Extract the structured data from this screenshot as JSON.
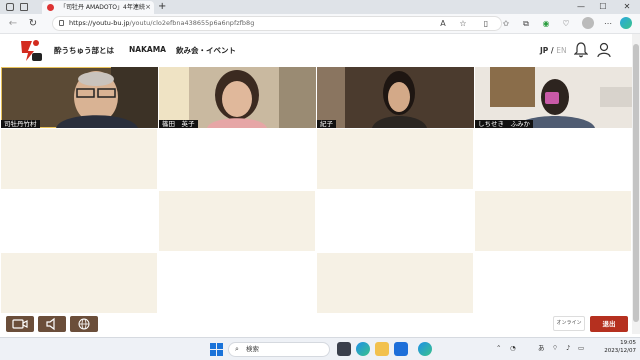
{
  "browser": {
    "tab_title": "「司牡丹 AMADOTO」4年連続",
    "tab_close": "×",
    "new_tab": "+",
    "url_domain": "https://youtu-bu.jp",
    "url_path": "/youtu/clo2efbna438655p6a6npfzfb8g",
    "window_controls": {
      "minimize": "—",
      "maximize": "☐",
      "close": "✕"
    }
  },
  "site": {
    "logo_text": "酔",
    "nav": [
      "酔うちゅう部とは",
      "NAKAMA",
      "飲み会・イベント"
    ],
    "lang_jp": "JP",
    "lang_sep": " / ",
    "lang_en": "EN"
  },
  "participants": [
    {
      "name": "司牡丹竹村"
    },
    {
      "name": "篠田　英子"
    },
    {
      "name": "紀子"
    },
    {
      "name": "しちせき　ふみか"
    }
  ],
  "controls": {
    "online_label": "オンライン",
    "leave_label": "退出"
  },
  "taskbar": {
    "search_placeholder": "検索",
    "lang_indicator": "あ",
    "time": "19:05",
    "date": "2023/12/07"
  },
  "colors": {
    "leave_button": "#b5301f",
    "control_button": "#6b4e3a",
    "cream_cell": "#f6f1e5"
  }
}
